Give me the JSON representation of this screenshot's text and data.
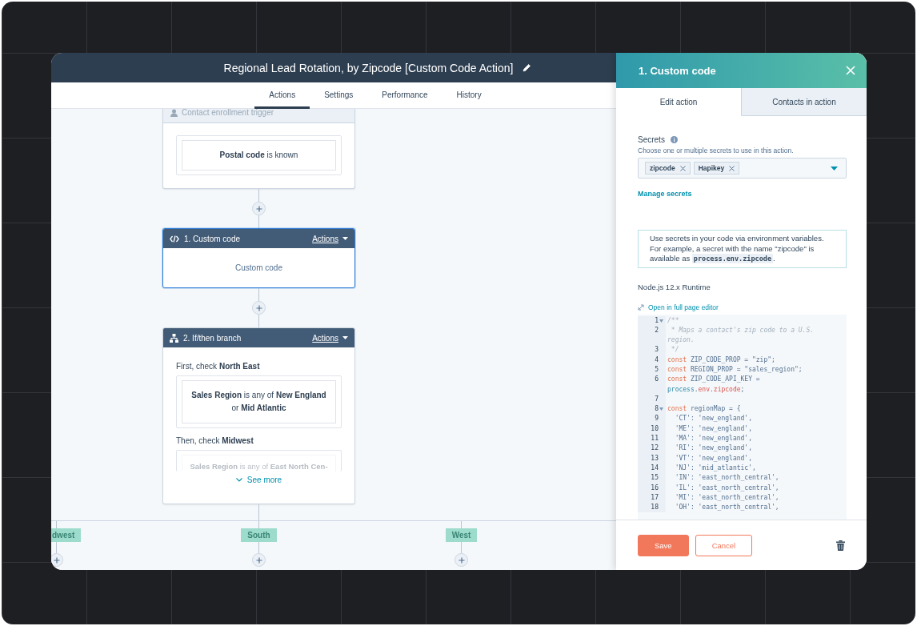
{
  "workflow": {
    "title": "Regional Lead Rotation, by Zipcode [Custom Code Action]",
    "tabs": [
      {
        "label": "Actions",
        "selected": true
      },
      {
        "label": "Settings",
        "selected": false
      },
      {
        "label": "Performance",
        "selected": false
      },
      {
        "label": "History",
        "selected": false
      }
    ]
  },
  "canvas": {
    "trigger": {
      "header": "Contact enrollment trigger",
      "condition": "**Postal code** is known"
    },
    "actions": [
      {
        "kind": "custom_code",
        "header": "1. Custom code",
        "menu": "Actions",
        "selected": true,
        "body": "Custom code"
      },
      {
        "kind": "branch",
        "header": "2. If/then branch",
        "menu": "Actions",
        "selected": false,
        "checks": [
          {
            "label": "First, check **North East**",
            "condition": "**Sales Region** is any of **New England** or **Mid Atlantic**",
            "faded": false
          },
          {
            "label": "Then, check **Midwest**",
            "condition": "**Sales Region** is any of **East North Cen-**",
            "faded": true
          }
        ],
        "see_more": "See more"
      }
    ],
    "branches": [
      {
        "label": "dwest"
      },
      {
        "label": "South"
      },
      {
        "label": "West"
      }
    ]
  },
  "panel": {
    "title": "1. Custom code",
    "tabs": [
      {
        "label": "Edit action",
        "selected": true
      },
      {
        "label": "Contacts in action",
        "selected": false
      }
    ],
    "secrets": {
      "label": "Secrets",
      "hint": "Choose one or multiple secrets to use in this action.",
      "tags": [
        {
          "label": "zipcode"
        },
        {
          "label": "Hapikey"
        }
      ]
    },
    "manage_link": "Manage secrets",
    "info": {
      "text_before": "Use secrets in your code via environment variables. For example, a secret with the name \"zipcode\" is available as ",
      "code": "process.env.zipcode",
      "text_after": "."
    },
    "runtime": "Node.js 12.x Runtime",
    "editor_link": "Open in full page editor",
    "code": [
      {
        "number": "1",
        "fold": true,
        "tokens": [
          {
            "kind": "comment",
            "text": "/**"
          }
        ]
      },
      {
        "number": "2",
        "fold": false,
        "tokens": [
          {
            "kind": "comment",
            "text": " * Maps a contact's zip code to a U.S. region."
          }
        ]
      },
      {
        "number": "3",
        "fold": false,
        "tokens": [
          {
            "kind": "comment",
            "text": " */"
          }
        ]
      },
      {
        "number": "4",
        "fold": false,
        "tokens": [
          {
            "kind": "keyword",
            "text": "const "
          },
          {
            "kind": "plain",
            "text": "ZIP_CODE_PROP = \"zip\";"
          }
        ]
      },
      {
        "number": "5",
        "fold": false,
        "tokens": [
          {
            "kind": "keyword",
            "text": "const "
          },
          {
            "kind": "plain",
            "text": "REGION_PROP = \"sales_region\";"
          }
        ]
      },
      {
        "number": "6",
        "fold": false,
        "tokens": [
          {
            "kind": "keyword",
            "text": "const "
          },
          {
            "kind": "plain",
            "text": "ZIP_CODE_API_KEY = "
          },
          {
            "kind": "object",
            "text": "process"
          },
          {
            "kind": "plain",
            "text": "."
          },
          {
            "kind": "property",
            "text": "env"
          },
          {
            "kind": "plain",
            "text": "."
          },
          {
            "kind": "property",
            "text": "zipcode"
          },
          {
            "kind": "plain",
            "text": ";"
          }
        ]
      },
      {
        "number": "7",
        "fold": false
      },
      {
        "number": "8",
        "fold": true,
        "tokens": [
          {
            "kind": "keyword",
            "text": "const "
          },
          {
            "kind": "plain",
            "text": "regionMap = {"
          }
        ]
      },
      {
        "number": "9",
        "fold": false,
        "tokens": [
          {
            "kind": "plain",
            "text": "  'CT': 'new_england',"
          }
        ]
      },
      {
        "number": "10",
        "fold": false,
        "tokens": [
          {
            "kind": "plain",
            "text": "  'ME': 'new_england',"
          }
        ]
      },
      {
        "number": "11",
        "fold": false,
        "tokens": [
          {
            "kind": "plain",
            "text": "  'MA': 'new_england',"
          }
        ]
      },
      {
        "number": "12",
        "fold": false,
        "tokens": [
          {
            "kind": "plain",
            "text": "  'RI': 'new_england',"
          }
        ]
      },
      {
        "number": "13",
        "fold": false,
        "tokens": [
          {
            "kind": "plain",
            "text": "  'VT': 'new_england',"
          }
        ]
      },
      {
        "number": "14",
        "fold": false,
        "tokens": [
          {
            "kind": "plain",
            "text": "  'NJ': 'mid_atlantic',"
          }
        ]
      },
      {
        "number": "15",
        "fold": false,
        "tokens": [
          {
            "kind": "plain",
            "text": "  'IN': 'east_north_central',"
          }
        ]
      },
      {
        "number": "16",
        "fold": false,
        "tokens": [
          {
            "kind": "plain",
            "text": "  'IL': 'east_north_central',"
          }
        ]
      },
      {
        "number": "17",
        "fold": false,
        "tokens": [
          {
            "kind": "plain",
            "text": "  'MI': 'east_north_central',"
          }
        ]
      },
      {
        "number": "18",
        "fold": false,
        "tokens": [
          {
            "kind": "plain",
            "text": "  'OH': 'east_north_central',"
          }
        ]
      }
    ],
    "buttons": [
      {
        "kind": "primary",
        "label": "Save"
      },
      {
        "kind": "secondary",
        "label": "Cancel"
      }
    ]
  }
}
